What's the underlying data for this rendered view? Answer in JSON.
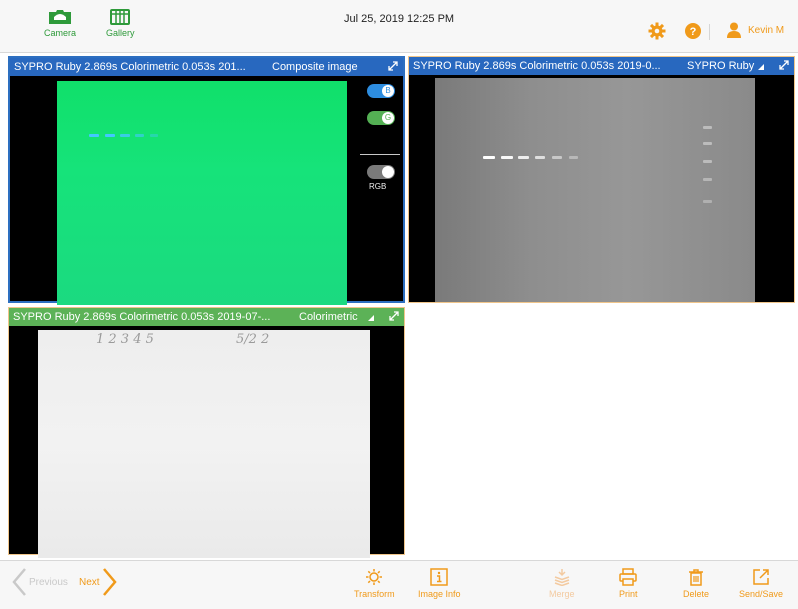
{
  "header": {
    "camera_label": "Camera",
    "gallery_label": "Gallery",
    "datetime": "Jul 25, 2019  12:25 PM",
    "user_name": "Kevin M",
    "accent_color": "#f09a1a",
    "green_color": "#2e9a3a"
  },
  "panels": [
    {
      "title": "SYPRO Ruby 2.869s Colorimetric 0.053s 201...",
      "mode": "Composite image",
      "selected": true,
      "channel_toggles": [
        {
          "label": "B",
          "on": true,
          "color": "#2d8de0"
        },
        {
          "label": "G",
          "on": true,
          "color": "#54b054"
        },
        {
          "label": "RGB",
          "on": true,
          "color": "#7a7a7a"
        }
      ]
    },
    {
      "title": "SYPRO Ruby 2.869s Colorimetric 0.053s 2019-0...",
      "mode": "SYPRO Ruby",
      "selected": false
    },
    {
      "title": "SYPRO Ruby 2.869s Colorimetric 0.053s 2019-07-...",
      "mode": "Colorimetric",
      "selected": false,
      "handwriting_left": "1 2 3 4 5",
      "handwriting_right": "5/2 2"
    }
  ],
  "footer": {
    "previous_label": "Previous",
    "next_label": "Next",
    "tools": [
      {
        "label": "Transform",
        "icon": "sun-icon",
        "enabled": true
      },
      {
        "label": "Image Info",
        "icon": "info-icon",
        "enabled": true
      },
      {
        "label": "Merge",
        "icon": "stack-icon",
        "enabled": false
      },
      {
        "label": "Print",
        "icon": "printer-icon",
        "enabled": true
      },
      {
        "label": "Delete",
        "icon": "trash-icon",
        "enabled": true
      },
      {
        "label": "Send/Save",
        "icon": "export-icon",
        "enabled": true
      }
    ]
  }
}
